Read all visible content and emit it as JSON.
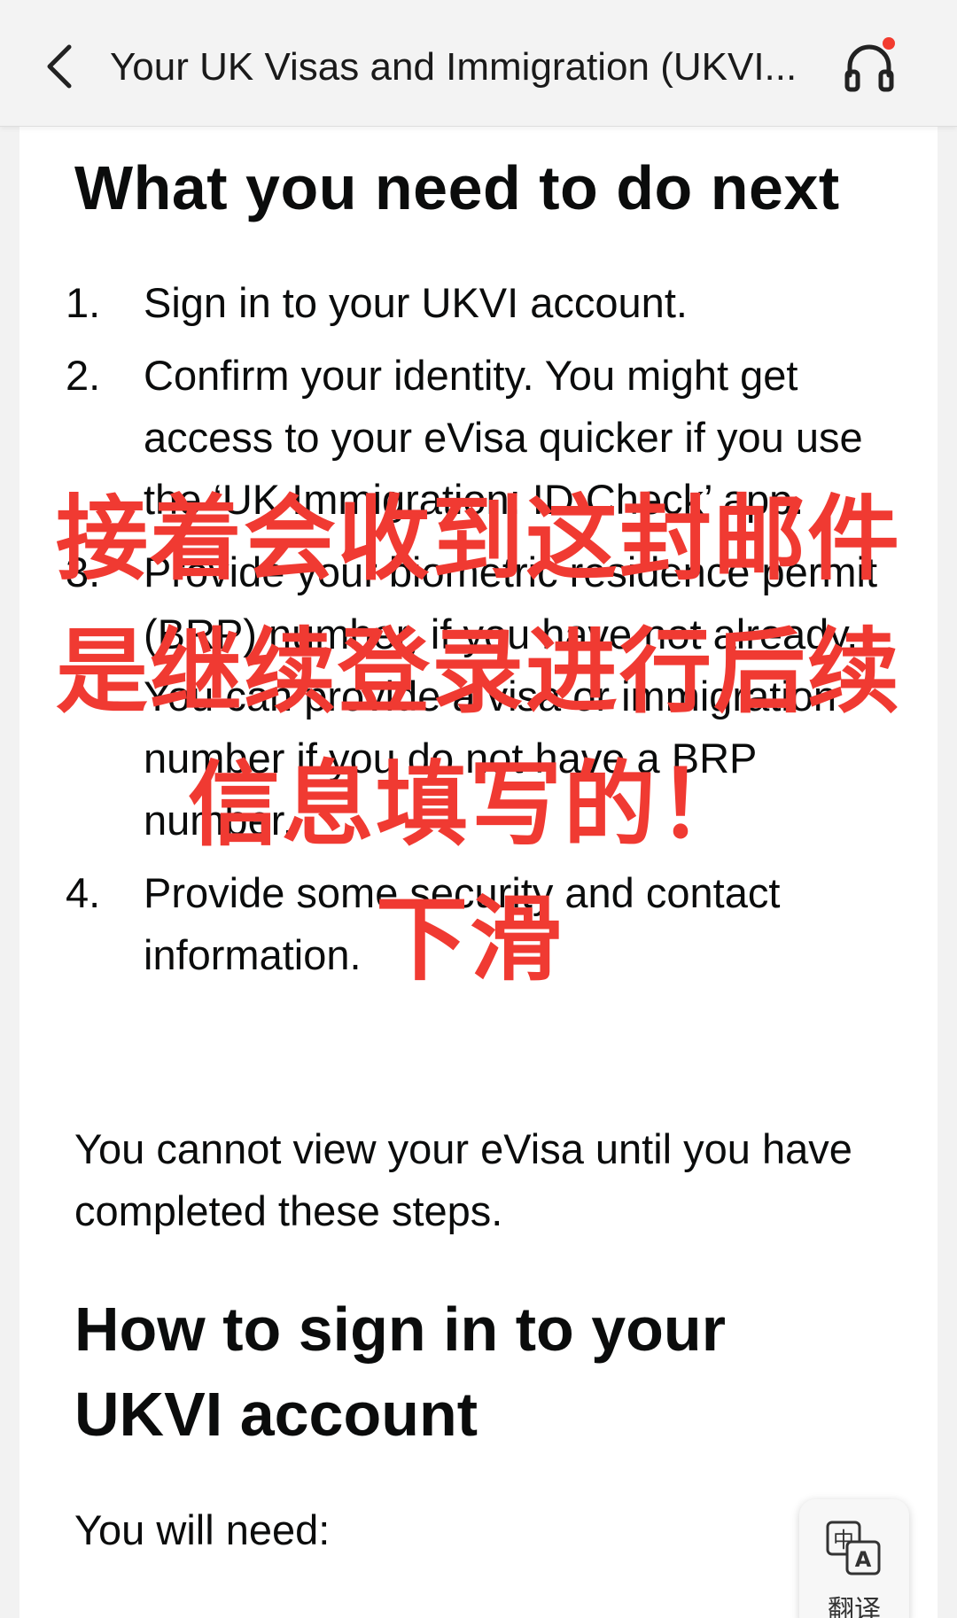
{
  "header": {
    "title": "Your UK Visas and Immigration (UKVI..."
  },
  "email": {
    "heading": "What you need to do next",
    "steps": [
      {
        "num": "1.",
        "text": "Sign in to your UKVI account."
      },
      {
        "num": "2.",
        "text": "Confirm your identity. You might get access to your eVisa quicker if you use the ‘UK Immigration: ID Check’ app."
      },
      {
        "num": "3.",
        "text": "Provide your biometric residence permit (BRP) number, if you have not already. You can provide a visa or immigration number if you do not have a BRP number."
      },
      {
        "num": "4.",
        "text": "Provide some security and contact information."
      }
    ],
    "paragraph": "You cannot view your eVisa until you have completed these steps.",
    "heading2": "How to sign in to your UKVI account",
    "need_label": "You will need:"
  },
  "overlay": {
    "line1": "接着会收到这封邮件",
    "line2": "是继续登录进行后续",
    "line3": "信息填写的！",
    "line4": "下滑",
    "color": "#f03a32"
  },
  "translate": {
    "label": "翻译",
    "icon": "translate-icon"
  },
  "icons": {
    "back": "chevron-left-icon",
    "support": "headset-icon"
  },
  "notification_dot_color": "#f23b2e"
}
